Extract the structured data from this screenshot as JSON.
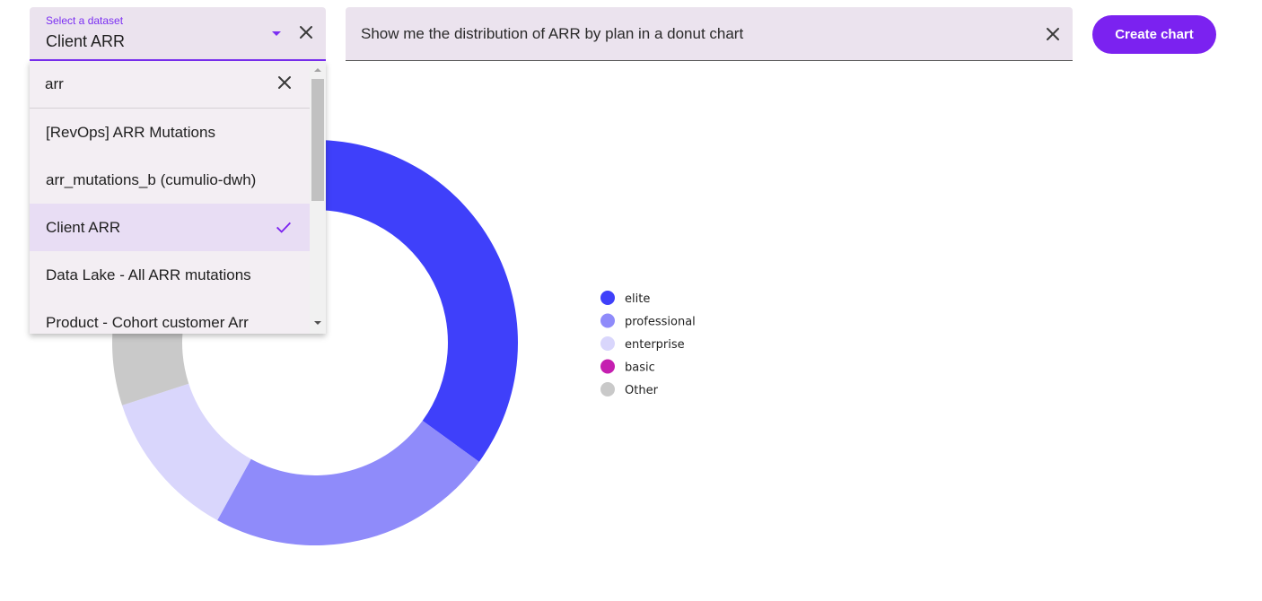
{
  "dataset_select": {
    "label": "Select a dataset",
    "value": "Client ARR",
    "arrow_icon": "dropdown-arrow-icon",
    "clear_icon": "close-icon"
  },
  "dropdown": {
    "search_value": "arr",
    "search_clear_icon": "close-icon",
    "items": [
      {
        "label": "[RevOps] ARR Mutations",
        "selected": false
      },
      {
        "label": "arr_mutations_b (cumulio-dwh)",
        "selected": false
      },
      {
        "label": "Client ARR",
        "selected": true
      },
      {
        "label": "Data Lake - All ARR mutations",
        "selected": false
      },
      {
        "label": "Product - Cohort customer Arr",
        "selected": false
      }
    ],
    "selected_icon": "checkmark-icon"
  },
  "query": {
    "text": "Show me the distribution of ARR by plan in a donut chart",
    "clear_icon": "close-icon"
  },
  "create_button": {
    "label": "Create chart"
  },
  "colors": {
    "accent": "#7b22f0",
    "field_bg": "#ebe3ee"
  },
  "chart_data": {
    "type": "pie",
    "donut": true,
    "categories": [
      "elite",
      "professional",
      "enterprise",
      "basic",
      "Other"
    ],
    "values": [
      35,
      23,
      12,
      0,
      30
    ],
    "colors": [
      "#3f40fa",
      "#8f8bfa",
      "#d9d6fc",
      "#c51fb0",
      "#c9c9c9"
    ],
    "legend_position": "right"
  }
}
